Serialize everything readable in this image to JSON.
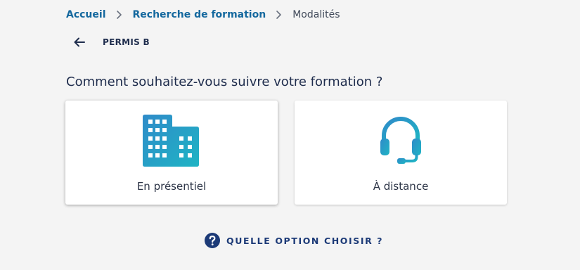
{
  "breadcrumb": {
    "items": [
      "Accueil",
      "Recherche de formation"
    ],
    "current": "Modalités"
  },
  "back": {
    "icon": "arrow-left-icon",
    "label": "PERMIS B"
  },
  "question": "Comment souhaitez-vous suivre votre formation ?",
  "options": [
    {
      "label": "En présentiel",
      "icon": "building-icon",
      "selected": true
    },
    {
      "label": "À distance",
      "icon": "headset-icon",
      "selected": false
    }
  ],
  "help": {
    "icon": "question-circle-icon",
    "label": "QUELLE OPTION CHOISIR ?"
  },
  "colors": {
    "background": "#f4f4f4",
    "link": "#14689e",
    "text_dark": "#1f2d4d",
    "icon_gradient_start": "#2f8bc9",
    "icon_gradient_end": "#1fb4c4",
    "help_blue": "#1c3a77"
  }
}
